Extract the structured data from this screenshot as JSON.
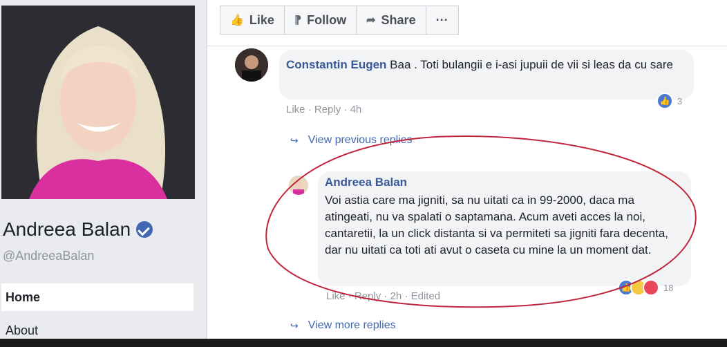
{
  "profile": {
    "name": "Andreea Balan",
    "handle": "@AndreeaBalan",
    "nav": [
      "Home",
      "About"
    ]
  },
  "actions": {
    "like": "Like",
    "follow": "Follow",
    "share": "Share",
    "more": "···"
  },
  "comments": [
    {
      "author": "Constantin Eugen",
      "text": " Baa . Toti bulangii e i-asi jupuii de vii si leas da cu sare",
      "like": "Like",
      "reply": "Reply",
      "time": "4h",
      "reaction_count": "3"
    },
    {
      "author": "Andreea Balan",
      "text": "Voi astia care ma jigniti, sa nu uitati ca in 99-2000, daca ma atingeati, nu va spalati o saptamana. Acum aveti acces la noi, cantaretii, la un click distanta si va permiteti sa jigniti fara decenta, dar nu uitati ca toti ati avut o caseta cu mine la un moment dat.",
      "like": "Like",
      "reply": "Reply",
      "time": "2h",
      "edited": "Edited",
      "reaction_count": "18"
    }
  ],
  "view_previous_replies": "View previous replies",
  "view_more_replies": "View more replies",
  "colors": {
    "link": "#385898",
    "highlight": "#c0243c",
    "background": "#e9ebee"
  }
}
